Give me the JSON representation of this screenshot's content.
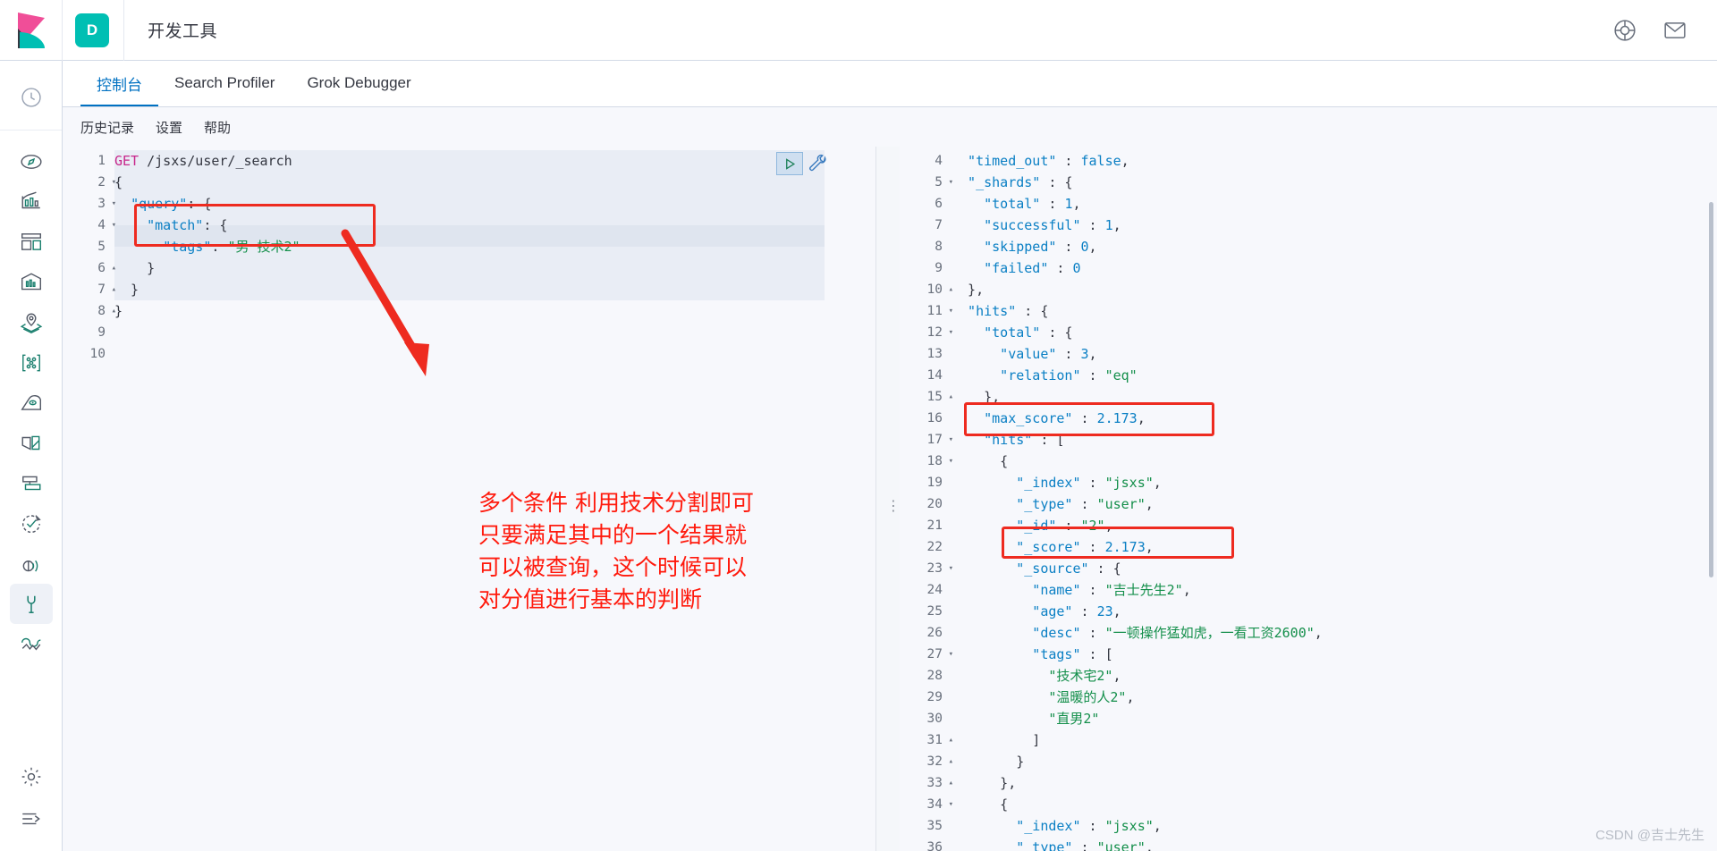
{
  "header": {
    "logo_icon": "kibana-logo-icon",
    "app_badge": "D",
    "title": "开发工具",
    "help_icon": "help-circle-icon",
    "mail_icon": "mail-icon"
  },
  "rail": {
    "recent_icon": "clock-recently-viewed-icon",
    "items": [
      {
        "name": "sidebar-item-discover",
        "icon": "compass-icon"
      },
      {
        "name": "sidebar-item-visualize",
        "icon": "bar-chart-icon"
      },
      {
        "name": "sidebar-item-dashboard",
        "icon": "dashboard-grid-icon"
      },
      {
        "name": "sidebar-item-canvas",
        "icon": "canvas-frame-icon"
      },
      {
        "name": "sidebar-item-maps",
        "icon": "map-pin-layers-icon"
      },
      {
        "name": "sidebar-item-ml",
        "icon": "machine-learning-icon"
      },
      {
        "name": "sidebar-item-infrastructure",
        "icon": "infrastructure-icon"
      },
      {
        "name": "sidebar-item-logs",
        "icon": "logs-icon"
      },
      {
        "name": "sidebar-item-apm",
        "icon": "apm-icon"
      },
      {
        "name": "sidebar-item-uptime",
        "icon": "uptime-check-icon"
      },
      {
        "name": "sidebar-item-siem",
        "icon": "siem-signal-icon"
      },
      {
        "name": "sidebar-item-dev-tools",
        "icon": "wrench-icon",
        "active": true
      },
      {
        "name": "sidebar-item-monitoring",
        "icon": "monitoring-wave-icon"
      }
    ],
    "bottom": [
      {
        "name": "sidebar-item-management",
        "icon": "gear-icon"
      },
      {
        "name": "sidebar-collapse-toggle",
        "icon": "collapse-arrow-icon"
      }
    ]
  },
  "tabs": [
    {
      "label": "控制台",
      "active": true
    },
    {
      "label": "Search Profiler",
      "active": false
    },
    {
      "label": "Grok Debugger",
      "active": false
    }
  ],
  "submenu": [
    "历史记录",
    "设置",
    "帮助"
  ],
  "request": {
    "play_icon": "play-triangle-icon",
    "wrench_icon": "wrench-icon",
    "lines": [
      {
        "n": 1,
        "fold": "",
        "tokens": [
          [
            "tok-method",
            "GET"
          ],
          [
            "tok-punc",
            " "
          ],
          [
            "tok-url",
            "/jsxs/user/_search"
          ]
        ]
      },
      {
        "n": 2,
        "fold": "▾",
        "tokens": [
          [
            "tok-punc",
            "{"
          ]
        ]
      },
      {
        "n": 3,
        "fold": "▾",
        "tokens": [
          [
            "tok-punc",
            "  "
          ],
          [
            "tok-key",
            "\"query\""
          ],
          [
            "tok-punc",
            ": {"
          ]
        ]
      },
      {
        "n": 4,
        "fold": "▾",
        "tokens": [
          [
            "tok-punc",
            "    "
          ],
          [
            "tok-key",
            "\"match\""
          ],
          [
            "tok-punc",
            ": {"
          ]
        ]
      },
      {
        "n": 5,
        "fold": "",
        "tokens": [
          [
            "tok-punc",
            "      "
          ],
          [
            "tok-key",
            "\"tags\""
          ],
          [
            "tok-punc",
            ": "
          ],
          [
            "tok-str",
            "\"男 技术2\""
          ]
        ]
      },
      {
        "n": 6,
        "fold": "▴",
        "tokens": [
          [
            "tok-punc",
            "    }"
          ]
        ]
      },
      {
        "n": 7,
        "fold": "▴",
        "tokens": [
          [
            "tok-punc",
            "  }"
          ]
        ]
      },
      {
        "n": 8,
        "fold": "▴",
        "tokens": [
          [
            "tok-punc",
            "}"
          ]
        ]
      },
      {
        "n": 9,
        "fold": "",
        "tokens": []
      },
      {
        "n": 10,
        "fold": "",
        "tokens": []
      }
    ]
  },
  "response": {
    "lines": [
      {
        "n": 4,
        "fold": "",
        "tokens": [
          [
            "tok-key",
            "  \"timed_out\""
          ],
          [
            "tok-punc",
            " : "
          ],
          [
            "tok-num",
            "false"
          ],
          [
            "tok-punc",
            ","
          ]
        ]
      },
      {
        "n": 5,
        "fold": "▾",
        "tokens": [
          [
            "tok-key",
            "  \"_shards\""
          ],
          [
            "tok-punc",
            " : {"
          ]
        ]
      },
      {
        "n": 6,
        "fold": "",
        "tokens": [
          [
            "tok-key",
            "    \"total\""
          ],
          [
            "tok-punc",
            " : "
          ],
          [
            "tok-num",
            "1"
          ],
          [
            "tok-punc",
            ","
          ]
        ]
      },
      {
        "n": 7,
        "fold": "",
        "tokens": [
          [
            "tok-key",
            "    \"successful\""
          ],
          [
            "tok-punc",
            " : "
          ],
          [
            "tok-num",
            "1"
          ],
          [
            "tok-punc",
            ","
          ]
        ]
      },
      {
        "n": 8,
        "fold": "",
        "tokens": [
          [
            "tok-key",
            "    \"skipped\""
          ],
          [
            "tok-punc",
            " : "
          ],
          [
            "tok-num",
            "0"
          ],
          [
            "tok-punc",
            ","
          ]
        ]
      },
      {
        "n": 9,
        "fold": "",
        "tokens": [
          [
            "tok-key",
            "    \"failed\""
          ],
          [
            "tok-punc",
            " : "
          ],
          [
            "tok-num",
            "0"
          ]
        ]
      },
      {
        "n": 10,
        "fold": "▴",
        "tokens": [
          [
            "tok-punc",
            "  },"
          ]
        ]
      },
      {
        "n": 11,
        "fold": "▾",
        "tokens": [
          [
            "tok-key",
            "  \"hits\""
          ],
          [
            "tok-punc",
            " : {"
          ]
        ]
      },
      {
        "n": 12,
        "fold": "▾",
        "tokens": [
          [
            "tok-key",
            "    \"total\""
          ],
          [
            "tok-punc",
            " : {"
          ]
        ]
      },
      {
        "n": 13,
        "fold": "",
        "tokens": [
          [
            "tok-key",
            "      \"value\""
          ],
          [
            "tok-punc",
            " : "
          ],
          [
            "tok-num",
            "3"
          ],
          [
            "tok-punc",
            ","
          ]
        ]
      },
      {
        "n": 14,
        "fold": "",
        "tokens": [
          [
            "tok-key",
            "      \"relation\""
          ],
          [
            "tok-punc",
            " : "
          ],
          [
            "tok-str",
            "\"eq\""
          ]
        ]
      },
      {
        "n": 15,
        "fold": "▴",
        "tokens": [
          [
            "tok-punc",
            "    },"
          ]
        ]
      },
      {
        "n": 16,
        "fold": "",
        "tokens": [
          [
            "tok-key",
            "    \"max_score\""
          ],
          [
            "tok-punc",
            " : "
          ],
          [
            "tok-num",
            "2.173"
          ],
          [
            "tok-punc",
            ","
          ]
        ]
      },
      {
        "n": 17,
        "fold": "▾",
        "tokens": [
          [
            "tok-key",
            "    \"hits\""
          ],
          [
            "tok-punc",
            " : ["
          ]
        ]
      },
      {
        "n": 18,
        "fold": "▾",
        "tokens": [
          [
            "tok-punc",
            "      {"
          ]
        ]
      },
      {
        "n": 19,
        "fold": "",
        "tokens": [
          [
            "tok-key",
            "        \"_index\""
          ],
          [
            "tok-punc",
            " : "
          ],
          [
            "tok-str",
            "\"jsxs\""
          ],
          [
            "tok-punc",
            ","
          ]
        ]
      },
      {
        "n": 20,
        "fold": "",
        "tokens": [
          [
            "tok-key",
            "        \"_type\""
          ],
          [
            "tok-punc",
            " : "
          ],
          [
            "tok-str",
            "\"user\""
          ],
          [
            "tok-punc",
            ","
          ]
        ]
      },
      {
        "n": 21,
        "fold": "",
        "tokens": [
          [
            "tok-key",
            "        \"_id\""
          ],
          [
            "tok-punc",
            " : "
          ],
          [
            "tok-str",
            "\"2\""
          ],
          [
            "tok-punc",
            ","
          ]
        ]
      },
      {
        "n": 22,
        "fold": "",
        "tokens": [
          [
            "tok-key",
            "        \"_score\""
          ],
          [
            "tok-punc",
            " : "
          ],
          [
            "tok-num",
            "2.173"
          ],
          [
            "tok-punc",
            ","
          ]
        ]
      },
      {
        "n": 23,
        "fold": "▾",
        "tokens": [
          [
            "tok-key",
            "        \"_source\""
          ],
          [
            "tok-punc",
            " : {"
          ]
        ]
      },
      {
        "n": 24,
        "fold": "",
        "tokens": [
          [
            "tok-key",
            "          \"name\""
          ],
          [
            "tok-punc",
            " : "
          ],
          [
            "tok-str",
            "\"吉士先生2\""
          ],
          [
            "tok-punc",
            ","
          ]
        ]
      },
      {
        "n": 25,
        "fold": "",
        "tokens": [
          [
            "tok-key",
            "          \"age\""
          ],
          [
            "tok-punc",
            " : "
          ],
          [
            "tok-num",
            "23"
          ],
          [
            "tok-punc",
            ","
          ]
        ]
      },
      {
        "n": 26,
        "fold": "",
        "tokens": [
          [
            "tok-key",
            "          \"desc\""
          ],
          [
            "tok-punc",
            " : "
          ],
          [
            "tok-str",
            "\"一顿操作猛如虎，一看工资2600\""
          ],
          [
            "tok-punc",
            ","
          ]
        ]
      },
      {
        "n": 27,
        "fold": "▾",
        "tokens": [
          [
            "tok-key",
            "          \"tags\""
          ],
          [
            "tok-punc",
            " : ["
          ]
        ]
      },
      {
        "n": 28,
        "fold": "",
        "tokens": [
          [
            "tok-str",
            "            \"技术宅2\""
          ],
          [
            "tok-punc",
            ","
          ]
        ]
      },
      {
        "n": 29,
        "fold": "",
        "tokens": [
          [
            "tok-str",
            "            \"温暖的人2\""
          ],
          [
            "tok-punc",
            ","
          ]
        ]
      },
      {
        "n": 30,
        "fold": "",
        "tokens": [
          [
            "tok-str",
            "            \"直男2\""
          ]
        ]
      },
      {
        "n": 31,
        "fold": "▴",
        "tokens": [
          [
            "tok-punc",
            "          ]"
          ]
        ]
      },
      {
        "n": 32,
        "fold": "▴",
        "tokens": [
          [
            "tok-punc",
            "        }"
          ]
        ]
      },
      {
        "n": 33,
        "fold": "▴",
        "tokens": [
          [
            "tok-punc",
            "      },"
          ]
        ]
      },
      {
        "n": 34,
        "fold": "▾",
        "tokens": [
          [
            "tok-punc",
            "      {"
          ]
        ]
      },
      {
        "n": 35,
        "fold": "",
        "tokens": [
          [
            "tok-key",
            "        \"_index\""
          ],
          [
            "tok-punc",
            " : "
          ],
          [
            "tok-str",
            "\"jsxs\""
          ],
          [
            "tok-punc",
            ","
          ]
        ]
      },
      {
        "n": 36,
        "fold": "",
        "tokens": [
          [
            "tok-key",
            "        \"_type\""
          ],
          [
            "tok-punc",
            " : "
          ],
          [
            "tok-str",
            "\"user\""
          ],
          [
            "tok-punc",
            ","
          ]
        ]
      }
    ]
  },
  "annotations": {
    "color": "#ff1a0d",
    "note_lines": [
      "多个条件 利用技术分割即可",
      "只要满足其中的一个结果就",
      "可以被查询，这个时候可以",
      "对分值进行基本的判断"
    ],
    "boxes": [
      {
        "name": "highlight-box-tags-query"
      },
      {
        "name": "highlight-box-max-score"
      },
      {
        "name": "highlight-box-score"
      }
    ],
    "arrow_name": "annotation-arrow"
  },
  "watermark": "CSDN @吉士先生"
}
